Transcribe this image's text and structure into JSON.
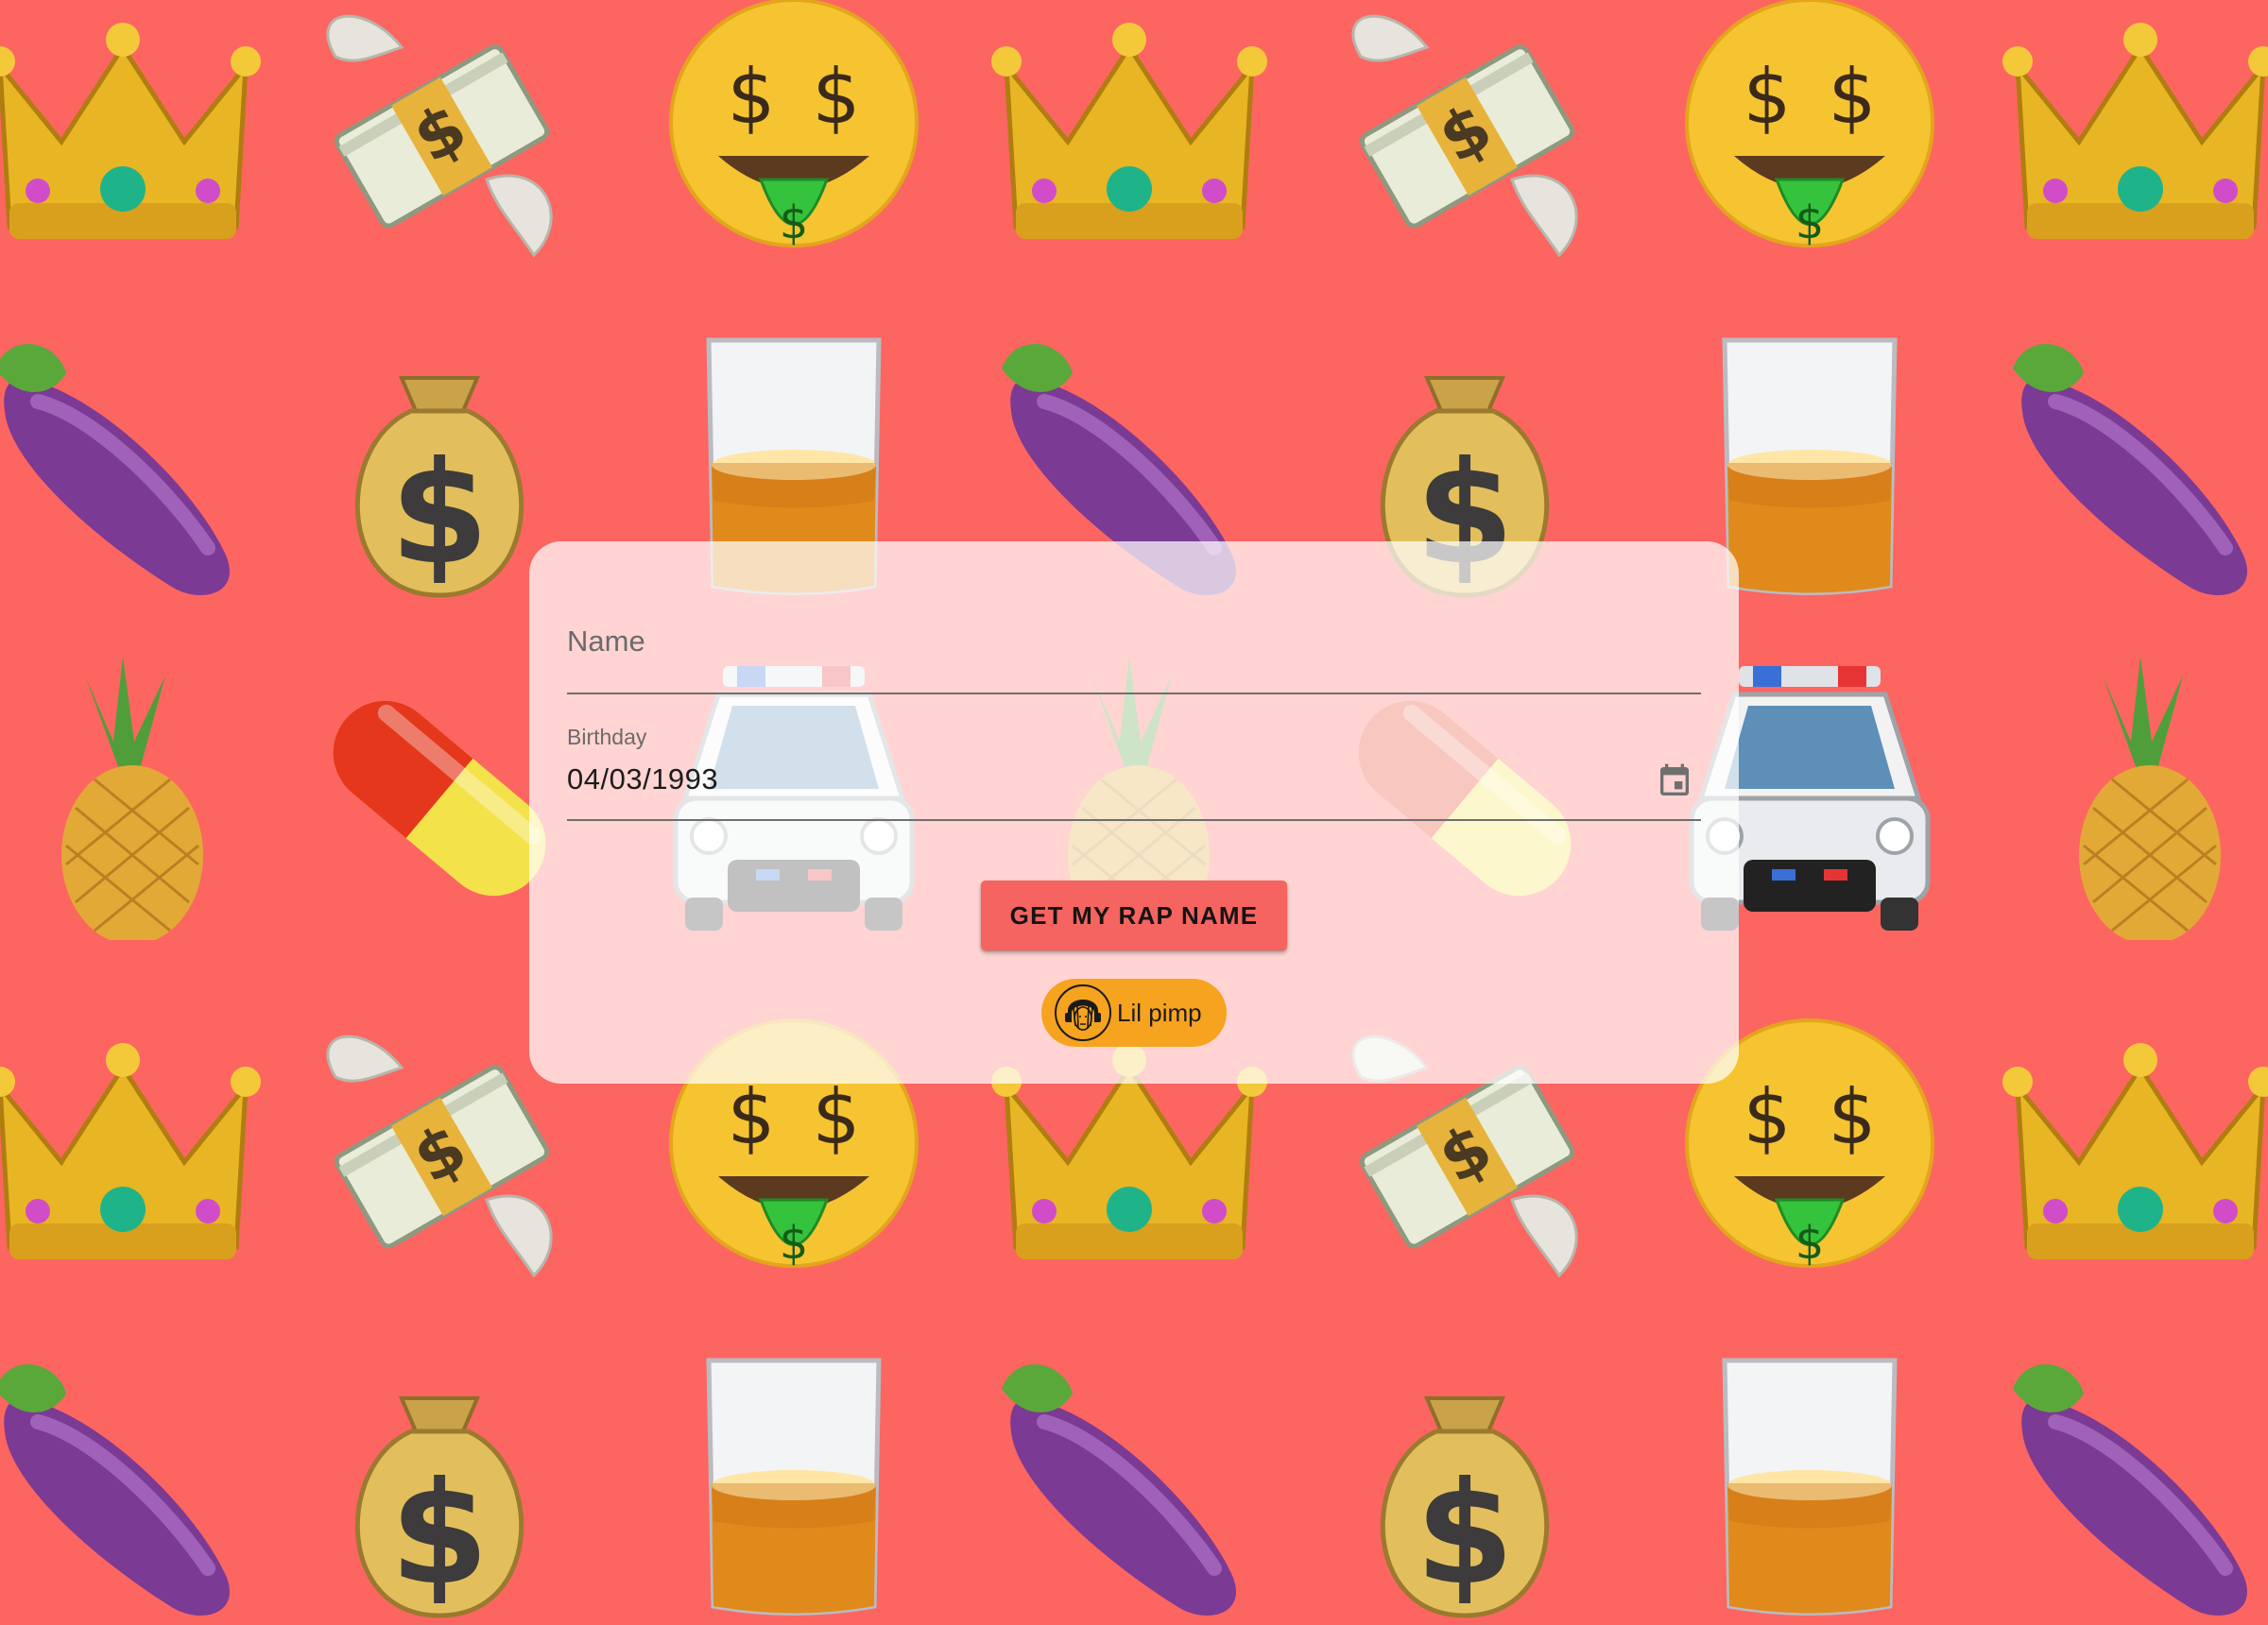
{
  "background": {
    "color": "#fd6561",
    "emoji_rows": [
      [
        "crown-icon",
        "money-with-wings-icon",
        "money-mouth-face-icon",
        "crown-icon",
        "money-with-wings-icon",
        "money-mouth-face-icon",
        "crown-icon"
      ],
      [
        "eggplant-icon",
        "money-bag-icon",
        "whiskey-glass-icon",
        "eggplant-icon",
        "money-bag-icon",
        "whiskey-glass-icon",
        "eggplant-icon"
      ],
      [
        "pineapple-icon",
        "pill-icon",
        "police-car-icon",
        "pineapple-icon",
        "pill-icon",
        "police-car-icon",
        "pineapple-icon"
      ],
      [
        "crown-icon",
        "money-with-wings-icon",
        "money-mouth-face-icon",
        "crown-icon",
        "money-with-wings-icon",
        "money-mouth-face-icon",
        "crown-icon"
      ],
      [
        "eggplant-icon",
        "money-bag-icon",
        "whiskey-glass-icon",
        "eggplant-icon",
        "money-bag-icon",
        "whiskey-glass-icon",
        "eggplant-icon"
      ]
    ]
  },
  "form": {
    "name_placeholder": "Name",
    "name_value": "",
    "birthday_label": "Birthday",
    "birthday_value": "04/03/1993",
    "calendar_icon": "calendar-icon",
    "submit_label": "GET MY RAP NAME"
  },
  "result": {
    "rap_name": "Lil pimp",
    "avatar_icon": "rapper-avatar-icon",
    "chip_color": "#f6a31f"
  },
  "colors": {
    "accent": "#f56460",
    "chip": "#f6a31f"
  }
}
